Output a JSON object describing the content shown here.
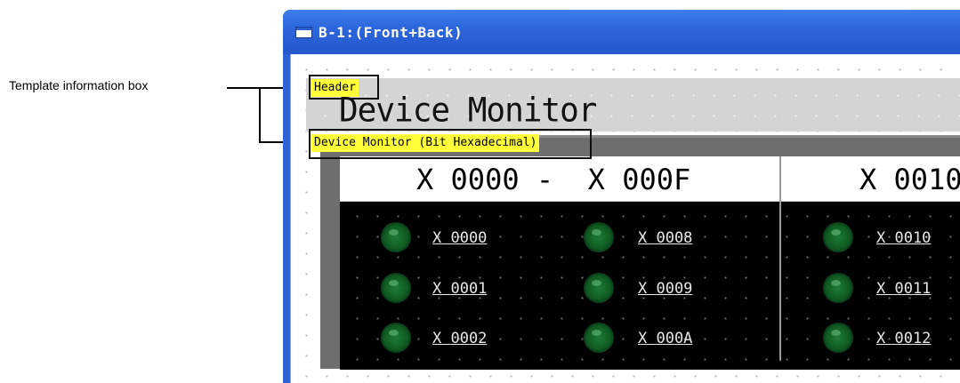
{
  "callout": {
    "label": "Template information box"
  },
  "window": {
    "title": "B-1:(Front+Back)"
  },
  "header": {
    "tag": "Header",
    "title": "Device Monitor"
  },
  "device_monitor": {
    "tag": "Device Monitor (Bit Hexadecimal)",
    "ranges": [
      {
        "label": "X 0000 -  X 000F"
      },
      {
        "label": "X 0010"
      }
    ],
    "devices": [
      {
        "label": "X 0000"
      },
      {
        "label": "X 0001"
      },
      {
        "label": "X 0002"
      },
      {
        "label": "X 0008"
      },
      {
        "label": "X 0009"
      },
      {
        "label": "X 000A"
      },
      {
        "label": "X 0010"
      },
      {
        "label": "X 0011"
      },
      {
        "label": "X 0012"
      }
    ],
    "led_color": "#1e7a35"
  }
}
